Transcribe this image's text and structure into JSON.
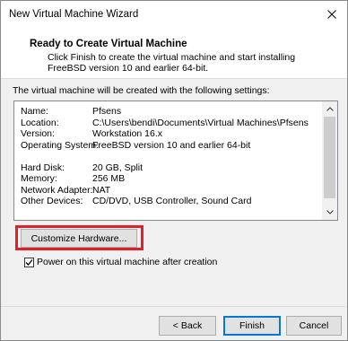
{
  "window": {
    "title": "New Virtual Machine Wizard"
  },
  "header": {
    "title": "Ready to Create Virtual Machine",
    "description": "Click Finish to create the virtual machine and start installing FreeBSD version 10 and earlier 64-bit."
  },
  "intro": "The virtual machine will be created with the following settings:",
  "settings": {
    "name_label": "Name:",
    "name_value": "Pfsens",
    "location_label": "Location:",
    "location_value": "C:\\Users\\bendi\\Documents\\Virtual Machines\\Pfsens",
    "version_label": "Version:",
    "version_value": "Workstation 16.x",
    "os_label": "Operating System:",
    "os_value": "FreeBSD version 10 and earlier 64-bit",
    "disk_label": "Hard Disk:",
    "disk_value": "20 GB, Split",
    "memory_label": "Memory:",
    "memory_value": "256 MB",
    "network_label": "Network Adapter:",
    "network_value": "NAT",
    "devices_label": "Other Devices:",
    "devices_value": "CD/DVD, USB Controller, Sound Card"
  },
  "buttons": {
    "customize": "Customize Hardware...",
    "back": "< Back",
    "finish": "Finish",
    "cancel": "Cancel"
  },
  "checkbox": {
    "label": "Power on this virtual machine after creation",
    "checked": true
  },
  "colors": {
    "highlight": "#e3202a",
    "default_button_border": "#0078d7"
  }
}
